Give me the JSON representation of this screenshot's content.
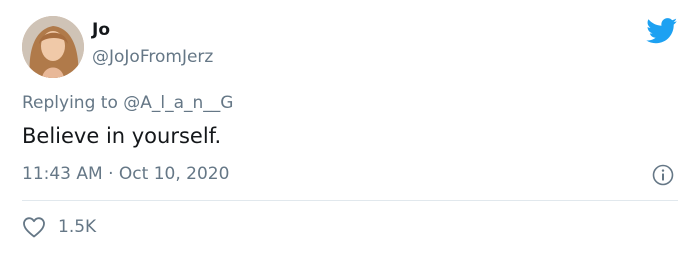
{
  "tweet": {
    "display_name": "Jo",
    "handle": "@JoJoFromJerz",
    "replying_prefix": "Replying to",
    "replying_to": "@A_l_a_n__G",
    "text": "Believe in yourself.",
    "time": "11:43 AM",
    "separator": "·",
    "date": "Oct 10, 2020",
    "like_count": "1.5K"
  },
  "icons": {
    "brand": "twitter-bird-icon",
    "info": "info-icon",
    "like": "heart-outline-icon"
  },
  "colors": {
    "brand": "#1da1f2",
    "text": "#14171a",
    "secondary": "#657786",
    "divider": "#e1e8ed"
  }
}
